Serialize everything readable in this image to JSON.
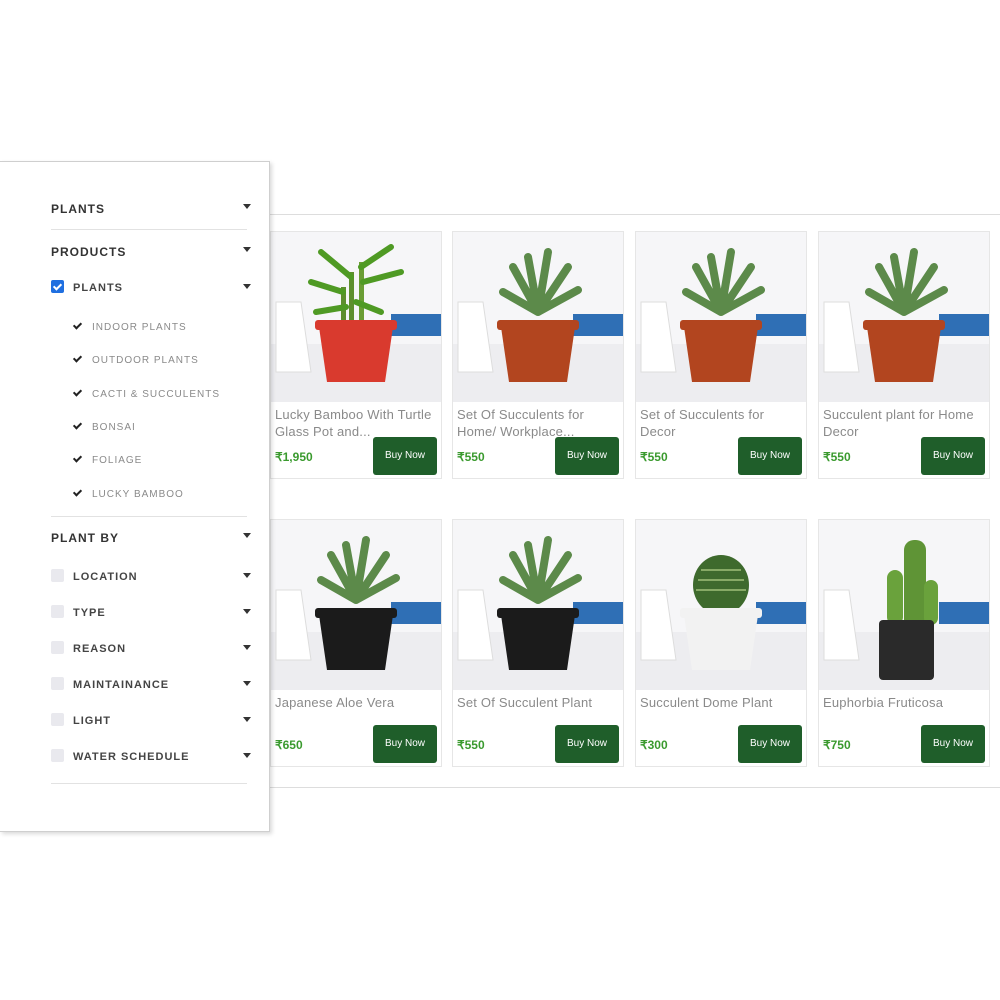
{
  "sidebar": {
    "plants_header": "PLANTS",
    "products_header": "PRODUCTS",
    "plants_checkbox_label": "PLANTS",
    "subcategories": [
      "INDOOR PLANTS",
      "OUTDOOR PLANTS",
      "CACTI & SUCCULENTS",
      "BONSAI",
      "FOLIAGE",
      "LUCKY BAMBOO"
    ],
    "plant_by_header": "PLANT BY",
    "plant_by_filters": [
      "LOCATION",
      "TYPE",
      "REASON",
      "MAINTAINANCE",
      "LIGHT",
      "WATER SCHEDULE"
    ]
  },
  "products": [
    {
      "name": "Lucky Bamboo With Turtle Glass Pot and...",
      "price": "₹1,950",
      "buy_label": "Buy Now",
      "pot_color": "#d93a2e"
    },
    {
      "name": "Set Of Succulents for Home/ Workplace...",
      "price": "₹550",
      "buy_label": "Buy Now",
      "pot_color": "#b2451f"
    },
    {
      "name": "Set of Succulents for Decor",
      "price": "₹550",
      "buy_label": "Buy Now",
      "pot_color": "#b2451f"
    },
    {
      "name": "Succulent plant for Home Decor",
      "price": "₹550",
      "buy_label": "Buy Now",
      "pot_color": "#b2451f"
    },
    {
      "name": "Japanese Aloe Vera",
      "price": "₹650",
      "buy_label": "Buy Now",
      "pot_color": "#1b1b1b"
    },
    {
      "name": "Set Of Succulent Plant",
      "price": "₹550",
      "buy_label": "Buy Now",
      "pot_color": "#1b1b1b"
    },
    {
      "name": "Succulent Dome Plant",
      "price": "₹300",
      "buy_label": "Buy Now",
      "pot_color": "#f2f2f2"
    },
    {
      "name": "Euphorbia Fruticosa",
      "price": "₹750",
      "buy_label": "Buy Now",
      "pot_color": "#2a2a2a"
    }
  ],
  "colors": {
    "buy_button": "#1f5e2a",
    "price_text": "#3a9a2e",
    "checkbox_checked": "#1f6fe0"
  }
}
